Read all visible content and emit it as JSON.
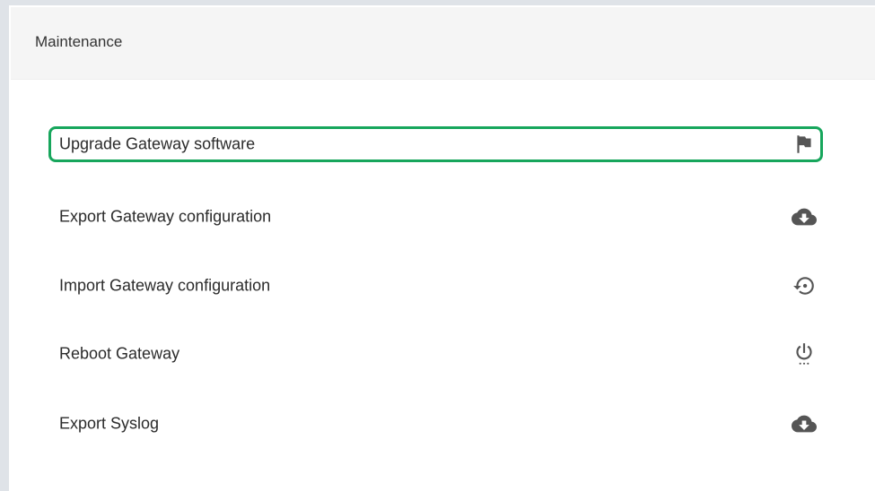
{
  "panel": {
    "title": "Maintenance"
  },
  "menu": {
    "items": [
      {
        "label": "Upgrade Gateway software",
        "icon": "flag-icon",
        "selected": true
      },
      {
        "label": "Export Gateway configuration",
        "icon": "cloud-download-icon",
        "selected": false
      },
      {
        "label": "Import Gateway configuration",
        "icon": "restore-icon",
        "selected": false
      },
      {
        "label": "Reboot Gateway",
        "icon": "power-icon",
        "selected": false
      },
      {
        "label": "Export Syslog",
        "icon": "cloud-download-icon",
        "selected": false
      }
    ]
  },
  "colors": {
    "selection_outline": "#17a65c",
    "icon": "#555555",
    "header_background": "#f5f5f5"
  }
}
